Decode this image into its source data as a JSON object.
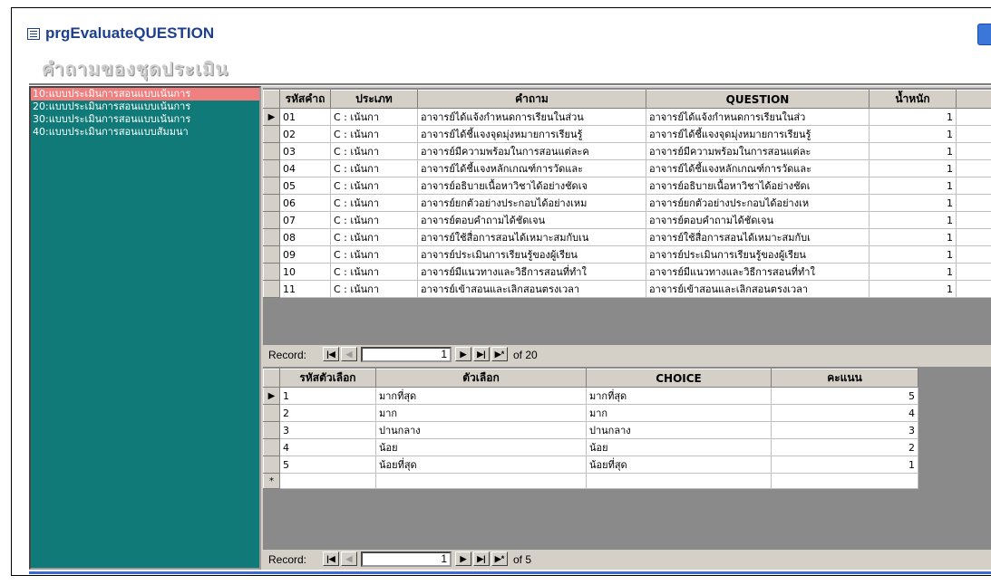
{
  "window": {
    "title": "prgEvaluateQUESTION"
  },
  "form": {
    "caption": "คำถามของชุดประเมิน"
  },
  "list": {
    "items": [
      "10:แบบประเมินการสอนแบบเน้นการ",
      "20:แบบประเมินการสอนแบบเน้นการ",
      "30:แบบประเมินการสอนแบบเน้นการ",
      "40:แบบประเมินการสอนแบบสัมมนา"
    ],
    "selected_index": 0
  },
  "questions": {
    "columns": [
      "รหัสคำถ",
      "ประเภท",
      "คำถาม",
      "QUESTION",
      "น้ำหนัก"
    ],
    "rows": [
      [
        "01",
        "C : เน้นกา",
        "อาจารย์ได้แจ้งกำหนดการเรียนในส่วน",
        "อาจารย์ได้แจ้งกำหนดการเรียนในส่ว",
        "1"
      ],
      [
        "02",
        "C : เน้นกา",
        "อาจารย์ได้ชี้แจงจุดมุ่งหมายการเรียนรู้",
        "อาจารย์ได้ชี้แจงจุดมุ่งหมายการเรียนรู้",
        "1"
      ],
      [
        "03",
        "C : เน้นกา",
        "อาจารย์มีความพร้อมในการสอนแต่ละค",
        "อาจารย์มีความพร้อมในการสอนแต่ละ",
        "1"
      ],
      [
        "04",
        "C : เน้นกา",
        "อาจารย์ได้ชี้แจงหลักเกณฑ์การวัดและ",
        "อาจารย์ได้ชี้แจงหลักเกณฑ์การวัดและ",
        "1"
      ],
      [
        "05",
        "C : เน้นกา",
        "อาจารย์อธิบายเนื้อหาวิชาได้อย่างชัดเจ",
        "อาจารย์อธิบายเนื้อหาวิชาได้อย่างชัดเ",
        "1"
      ],
      [
        "06",
        "C : เน้นกา",
        "อาจารย์ยกตัวอย่างประกอบได้อย่างเหม",
        "อาจารย์ยกตัวอย่างประกอบได้อย่างเห",
        "1"
      ],
      [
        "07",
        "C : เน้นกา",
        "อาจารย์ตอบคำถามได้ชัดเจน",
        "อาจารย์ตอบคำถามได้ชัดเจน",
        "1"
      ],
      [
        "08",
        "C : เน้นกา",
        "อาจารย์ใช้สื่อการสอนได้เหมาะสมกับเน",
        "อาจารย์ใช้สื่อการสอนได้เหมาะสมกับเ",
        "1"
      ],
      [
        "09",
        "C : เน้นกา",
        "อาจารย์ประเมินการเรียนรู้ของผู้เรียน",
        "อาจารย์ประเมินการเรียนรู้ของผู้เรียน",
        "1"
      ],
      [
        "10",
        "C : เน้นกา",
        "อาจารย์มีแนวทางและวิธีการสอนที่ทำใ",
        "อาจารย์มีแนวทางและวิธีการสอนที่ทำใ",
        "1"
      ],
      [
        "11",
        "C : เน้นกา",
        "อาจารย์เข้าสอนและเลิกสอนตรงเวลา",
        "อาจารย์เข้าสอนและเลิกสอนตรงเวลา",
        "1"
      ]
    ],
    "nav": {
      "label": "Record:",
      "current": "1",
      "of": "of 20"
    }
  },
  "choices": {
    "columns": [
      "รหัสตัวเลือก",
      "ตัวเลือก",
      "CHOICE",
      "คะแนน"
    ],
    "rows": [
      [
        "1",
        "มากที่สุด",
        "มากที่สุด",
        "5"
      ],
      [
        "2",
        "มาก",
        "มาก",
        "4"
      ],
      [
        "3",
        "ปานกลาง",
        "ปานกลาง",
        "3"
      ],
      [
        "4",
        "น้อย",
        "น้อย",
        "2"
      ],
      [
        "5",
        "น้อยที่สุด",
        "น้อยที่สุด",
        "1"
      ]
    ],
    "new_row_marker": "*",
    "nav": {
      "label": "Record:",
      "current": "1",
      "of": "of 5"
    }
  },
  "icons": {
    "current_record": "right-triangle",
    "first": "first-record-icon",
    "prev": "previous-record-icon",
    "next": "next-record-icon",
    "last": "last-record-icon",
    "new": "new-record-icon"
  },
  "colors": {
    "listbox_bg": "#0f7a78",
    "selected_item": "#f08080",
    "title_text": "#1d3f8f"
  }
}
